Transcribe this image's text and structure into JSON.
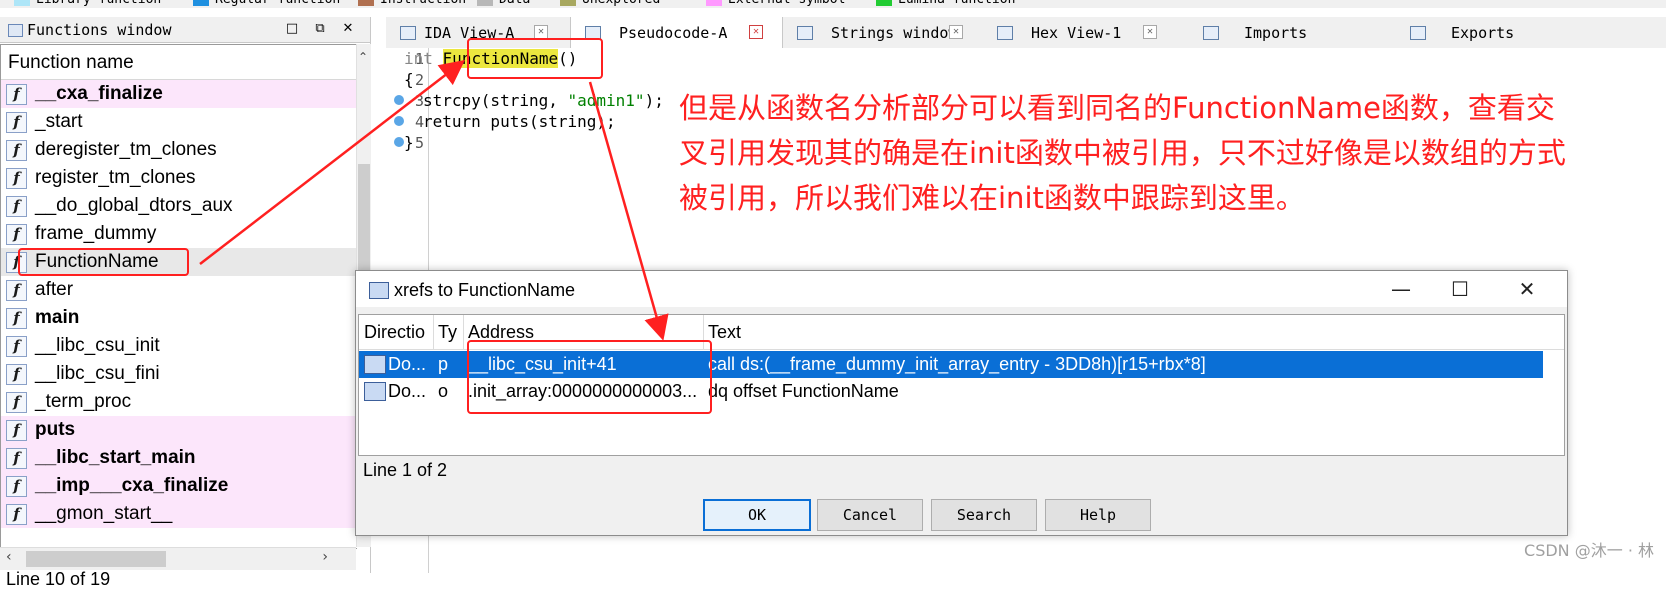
{
  "legend": {
    "items": [
      {
        "label": "Library function",
        "color": "#aee6f8"
      },
      {
        "label": "Regular function",
        "color": "#1f90e0"
      },
      {
        "label": "Instruction",
        "color": "#b07050"
      },
      {
        "label": "Data",
        "color": "#b8b8b8"
      },
      {
        "label": "Unexplored",
        "color": "#a8a860"
      },
      {
        "label": "External symbol",
        "color": "#ff99ff"
      },
      {
        "label": "Lumina function",
        "color": "#22cc33"
      }
    ]
  },
  "functions_window": {
    "title": "Functions window",
    "column_header": "Function name",
    "status": "Line 10 of 19",
    "items": [
      {
        "name": "__cxa_finalize",
        "style": "lib"
      },
      {
        "name": "_start",
        "style": "normal"
      },
      {
        "name": "deregister_tm_clones",
        "style": "normal"
      },
      {
        "name": "register_tm_clones",
        "style": "normal"
      },
      {
        "name": "__do_global_dtors_aux",
        "style": "normal"
      },
      {
        "name": "frame_dummy",
        "style": "normal"
      },
      {
        "name": "FunctionName",
        "style": "selected"
      },
      {
        "name": "after",
        "style": "normal"
      },
      {
        "name": "main",
        "style": "bold"
      },
      {
        "name": "__libc_csu_init",
        "style": "normal"
      },
      {
        "name": "__libc_csu_fini",
        "style": "normal"
      },
      {
        "name": "_term_proc",
        "style": "normal"
      },
      {
        "name": "puts",
        "style": "lib"
      },
      {
        "name": "__libc_start_main",
        "style": "lib"
      },
      {
        "name": "__imp___cxa_finalize",
        "style": "lib"
      },
      {
        "name": "__gmon_start__",
        "style": "lib-plain"
      }
    ]
  },
  "tabs": [
    {
      "label": "IDA View-A",
      "active": false
    },
    {
      "label": "Pseudocode-A",
      "active": true
    },
    {
      "label": "Strings window",
      "active": false
    },
    {
      "label": "Hex View-1",
      "active": false
    },
    {
      "label": "Imports",
      "active": false
    },
    {
      "label": "Exports",
      "active": false
    }
  ],
  "pseudocode": {
    "line_numbers": [
      "1",
      "2",
      "3",
      "4",
      "5"
    ],
    "line1": {
      "type": "int",
      "func": "FunctionName",
      "parens": "()"
    },
    "line2": "{",
    "line3": {
      "call": "strcpy(string, ",
      "literal": "\"admin1\"",
      "end": ");"
    },
    "line4": "return puts(string);",
    "line5": "}"
  },
  "annotation": "但是从函数名分析部分可以看到同名的FunctionName函数，查看交叉引用发现其的确是在init函数中被引用，只不过好像是以数组的方式被引用，所以我们难以在init函数中跟踪到这里。",
  "watermark": "CSDN @沐一 · 林",
  "xrefs_dialog": {
    "title": "xrefs to FunctionName",
    "columns": [
      "Directio",
      "Ty",
      "Address",
      "Text"
    ],
    "rows": [
      {
        "direction": "Do...",
        "type": "p",
        "address": "__libc_csu_init+41",
        "text": "call    ds:(__frame_dummy_init_array_entry - 3DD8h)[r15+rbx*8]",
        "selected": true
      },
      {
        "direction": "Do...",
        "type": "o",
        "address": ".init_array:0000000000003...",
        "text": "dq offset FunctionName",
        "selected": false
      }
    ],
    "status": "Line 1 of 2",
    "buttons": {
      "ok": "OK",
      "cancel": "Cancel",
      "search": "Search",
      "help": "Help"
    }
  },
  "annotation_color": "#ff2020"
}
